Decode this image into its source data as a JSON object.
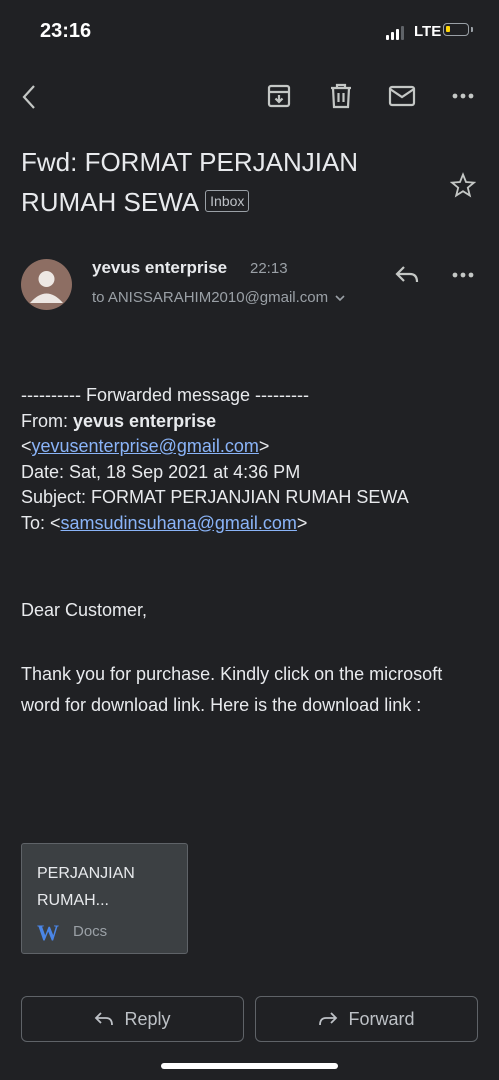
{
  "status_bar": {
    "time": "23:16",
    "network": "LTE",
    "signal_bars": 3,
    "battery_level": 0.2
  },
  "toolbar": {
    "back_icon": "chevron-left-icon",
    "archive_icon": "archive-icon",
    "delete_icon": "trash-icon",
    "mark_unread_icon": "mail-icon",
    "more_icon": "more-horizontal-icon"
  },
  "email": {
    "subject": "Fwd: FORMAT PERJANJIAN RUMAH SEWA",
    "label": "Inbox",
    "sender": "yevus enterprise",
    "time": "22:13",
    "to": "to ANISSARAHIM2010@gmail.com",
    "forwarded": {
      "header": "---------- Forwarded message ---------",
      "from_label": "From:",
      "from_name": "yevus enterprise",
      "from_email": "yevusenterprise@gmail.com",
      "date": "Date: Sat, 18 Sep 2021 at 4:36 PM",
      "subject": "Subject: FORMAT PERJANJIAN RUMAH SEWA",
      "to_label": "To:",
      "to_email": "samsudinsuhana@gmail.com"
    },
    "greeting": "Dear Customer,",
    "message": "Thank you for purchase. Kindly click on the microsoft word for download link. Here is the download link :",
    "attachment": {
      "name": "PERJANJIAN RUMAH...",
      "app_letter": "W",
      "app_label": "Docs"
    }
  },
  "actions": {
    "reply": "Reply",
    "forward": "Forward"
  },
  "colors": {
    "background": "#202124",
    "link": "#8ab4f8",
    "word_blue": "#4a86e8"
  }
}
